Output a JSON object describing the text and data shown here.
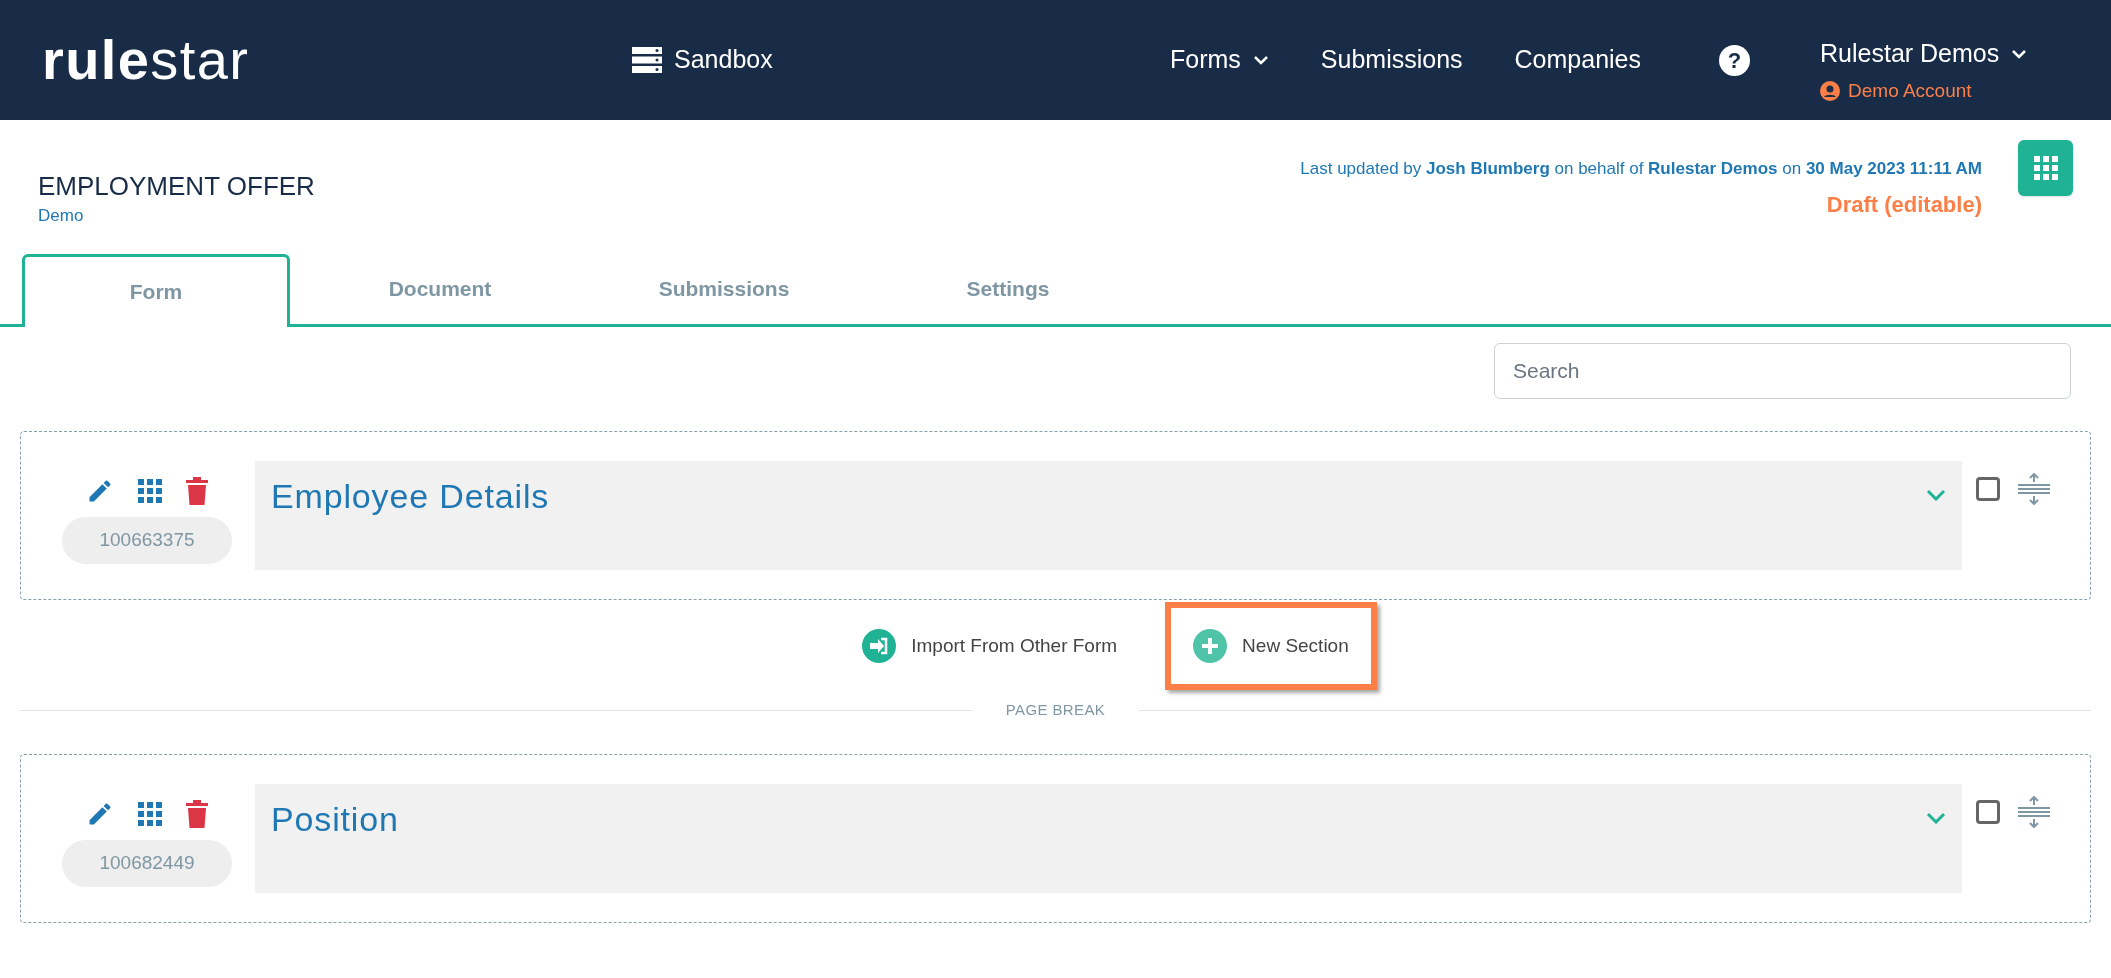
{
  "header": {
    "logo": "rulestar",
    "environment": "Sandbox",
    "nav": [
      {
        "label": "Forms",
        "dropdown": true
      },
      {
        "label": "Submissions",
        "dropdown": false
      },
      {
        "label": "Companies",
        "dropdown": false
      }
    ],
    "help": "?",
    "account": {
      "name": "Rulestar Demos",
      "role": "Demo Account"
    }
  },
  "form": {
    "title": "EMPLOYMENT OFFER",
    "subtitle": "Demo",
    "updated": "Last updated by **Josh Blumberg** on behalf of **Rulestar Demos** on **30 May 2023 11:11 AM**",
    "status": "Draft (editable)"
  },
  "tabs": [
    {
      "label": "Form",
      "selected": true
    },
    {
      "label": "Document",
      "selected": false
    },
    {
      "label": "Submissions",
      "selected": false
    },
    {
      "label": "Settings",
      "selected": false
    }
  ],
  "search": {
    "placeholder": "Search"
  },
  "sections": [
    {
      "title": "Employee Details",
      "id": "100663375",
      "checked": false
    },
    {
      "title": "Position",
      "id": "100682449",
      "checked": false
    }
  ],
  "actions": [
    {
      "kind": "import",
      "label": "Import From Other Form",
      "highlighted": false
    },
    {
      "kind": "new",
      "label": "New Section",
      "highlighted": true
    }
  ],
  "page_break": "PAGE BREAK"
}
